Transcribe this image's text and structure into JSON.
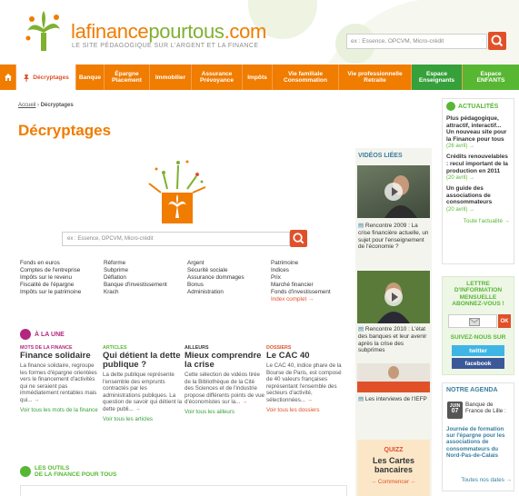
{
  "brand": {
    "logo_la": "la",
    "logo_finance": "finance",
    "logo_pour": "pour",
    "logo_tous": "tous",
    "logo_com": ".com",
    "tagline": "LE SITE PÉDAGOGIQUE SUR L'ARGENT ET LA FINANCE"
  },
  "header": {
    "search_placeholder": "ex : Essence, OPCVM, Micro-crédit"
  },
  "nav": {
    "items": [
      {
        "label": "Décryptages"
      },
      {
        "label": "Banque"
      },
      {
        "label": "Épargne Placement"
      },
      {
        "label": "Immobilier"
      },
      {
        "label": "Assurance Prévoyance"
      },
      {
        "label": "Impôts"
      },
      {
        "label": "Vie familiale Consommation"
      },
      {
        "label": "Vie professionnelle Retraite"
      },
      {
        "label": "Espace Enseignants"
      },
      {
        "label": "Espace ENFANTS"
      }
    ]
  },
  "breadcrumb": {
    "home": "Accueil",
    "sep": " › ",
    "current": "Décryptages"
  },
  "page": {
    "title": "Décryptages",
    "search_placeholder": "ex : Essence, OPCVM, Micro-crédit"
  },
  "keywords": {
    "col1": [
      "Fonds en euros",
      "Comptes de l'entreprise",
      "Impôts sur le revenu",
      "Fiscalité de l'épargne",
      "Impôts sur le patrimoine"
    ],
    "col2": [
      "Réforme",
      "Subprime",
      "Déflation",
      "Banque d'investissement",
      "Krach"
    ],
    "col3": [
      "Argent",
      "Sécurité sociale",
      "Assurance dommages",
      "Bonus",
      "Administration"
    ],
    "col4": [
      "Patrimoine",
      "Indices",
      "Prix",
      "Marché financier",
      "Fonds d'investissement"
    ],
    "more": "Index complet →"
  },
  "une": {
    "title": "À LA UNE",
    "cards": [
      {
        "cat": "MOTS DE LA FINANCE",
        "cat_color": "#b3287e",
        "title": "Finance solidaire",
        "text": "La finance solidaire, regroupe les formes d'épargne orientées vers le financement d'activités qui ne seraient pas immédiatement rentables mais qui...",
        "link": "Voir tous les mots de la finance"
      },
      {
        "cat": "ARTICLES",
        "cat_color": "#57b733",
        "title": "Qui détient la dette publique ?",
        "text": "La dette publique représente l'ensemble des emprunts contractés par les administrations publiques. La question de savoir qui détient la dette publi...",
        "link": "Voir tous les articles"
      },
      {
        "cat": "AILLEURS",
        "cat_color": "#333333",
        "title": "Mieux comprendre la crise",
        "text": "Cette sélection de vidéos tirée de la Bibliothèque de la Cité des Sciences et de l'industrie propose différents points de vue d'économistes sur la...",
        "link": "Voir tous les ailleurs"
      },
      {
        "cat": "DOSSIERS",
        "cat_color": "#e0512a",
        "title": "Le CAC 40",
        "text": "Le CAC 40, indice phare de la Bourse de Paris, est composé de 40 valeurs françaises représentant l'ensemble des secteurs d'activité, sélectionnées...",
        "link": "Voir tous les dossiers"
      }
    ]
  },
  "outils": {
    "title_line1": "LES OUTILS",
    "title_line2": "DE LA FINANCE POUR TOUS"
  },
  "videos": {
    "title": "VIDÉOS LIÉES",
    "items": [
      {
        "text": "Rencontre 2009 : La crise financière actuelle, un sujet pour l'enseignement de l'économie ?"
      },
      {
        "text": "Rencontre 2010 : L'état des banques et leur avenir après la crise des subprimes"
      },
      {
        "text": "Les interviews de l'IEFP"
      }
    ],
    "quiz_label": "QUIZZ",
    "quiz_title": "Les Cartes bancaires",
    "quiz_cta": "→ Commencer ←"
  },
  "actualites": {
    "title": "ACTUALITÉS",
    "items": [
      {
        "text": "Plus pédagogique, attractif, interactif... Un nouveau site pour la Finance pour tous",
        "date": "(26 avril) →"
      },
      {
        "text": "Crédits renouvelables : recul important de la production en 2011",
        "date": "(20 avril) →"
      },
      {
        "text": "Un guide des associations de consommateurs",
        "date": "(20 avril) →"
      }
    ],
    "all": "Toute l'actualité →"
  },
  "newsletter": {
    "title": "LETTRE D'INFORMATION MENSUELLE ABONNEZ-VOUS !",
    "ok": "OK",
    "follow": "SUIVEZ-NOUS SUR",
    "twitter": "twitter",
    "facebook": "facebook"
  },
  "agenda": {
    "title": "NOTRE AGENDA",
    "date_month": "JUIN",
    "date_day": "07",
    "place": "Banque de France de Lille :",
    "desc": "Journée de formation sur l'épargne pour les associations de consommateurs du Nord-Pas-de-Calais",
    "all": "Toutes nos dates →"
  },
  "colors": {
    "orange": "#f07c00",
    "green": "#57b733",
    "red": "#e0512a",
    "purple": "#b3287e",
    "blue": "#3a7fa0"
  }
}
